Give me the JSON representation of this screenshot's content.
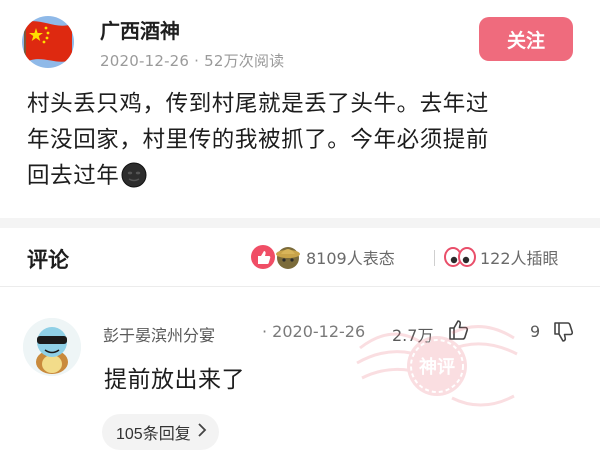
{
  "post": {
    "author_name": "广西酒神",
    "date": "2020-12-26",
    "views": "52万次阅读",
    "meta_separator": " · ",
    "follow_label": "关注",
    "body_line1": "村头丢只鸡，传到村尾就是丢了头牛。去年过",
    "body_line2": "年没回家，村里传的我被抓了。今年必须提前",
    "body_line3": "回去过年"
  },
  "comments_section": {
    "title": "评论",
    "reactions_label": "8109人表态",
    "insert_eye_label": "122人插眼"
  },
  "comment": {
    "user": "彭于晏滨州分宴",
    "date": "2020-12-26",
    "date_prefix": "· ",
    "likes": "2.7万",
    "dislikes": "9",
    "text": "提前放出来了",
    "replies_label": "105条回复",
    "watermark_text": "神评"
  },
  "icons": {
    "follow": "none",
    "emoji": "dark-face-emoji",
    "reaction_like": "thumbs-up-reaction-icon",
    "reaction_hat": "straw-hat-reaction-icon",
    "eye": "eyes-icon",
    "thumb_up": "thumb-up-icon",
    "thumb_down": "thumb-down-icon",
    "chevron": "chevron-right-icon"
  },
  "colors": {
    "accent": "#ef6b7d",
    "flag_red": "#de2910",
    "flag_star": "#ffde00",
    "meta_gray": "#9a9a9a"
  }
}
